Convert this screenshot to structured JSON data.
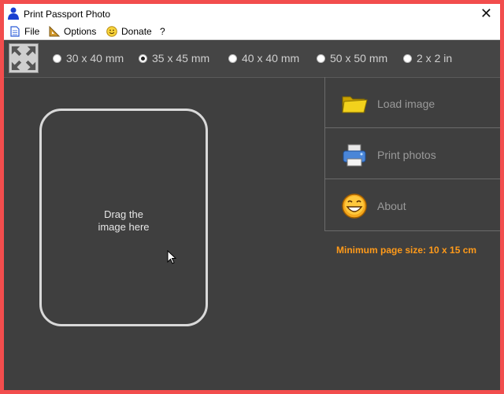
{
  "window": {
    "title": "Print Passport Photo",
    "close_glyph": "✕"
  },
  "menu": [
    {
      "label": "File",
      "icon": "document-icon"
    },
    {
      "label": "Options",
      "icon": "set-square-icon"
    },
    {
      "label": "Donate",
      "icon": "smiley-icon"
    },
    {
      "label": "?",
      "icon": ""
    }
  ],
  "sizes": [
    {
      "label": "30 x 40 mm",
      "selected": false
    },
    {
      "label": "35 x 45 mm",
      "selected": true
    },
    {
      "label": "40 x 40 mm",
      "selected": false
    },
    {
      "label": "50 x 50 mm",
      "selected": false
    },
    {
      "label": "2 x 2 in",
      "selected": false
    }
  ],
  "drop_zone": {
    "line1": "Drag the",
    "line2": "image here"
  },
  "actions": [
    {
      "label": "Load image",
      "icon": "folder-icon"
    },
    {
      "label": "Print photos",
      "icon": "printer-icon"
    },
    {
      "label": "About",
      "icon": "smiley-icon"
    }
  ],
  "min_page_size": "Minimum page size: 10 x 15 cm",
  "colors": {
    "accent_text": "#ff9a1a",
    "background": "#3f3f3f",
    "frame": "#f24d4d"
  }
}
